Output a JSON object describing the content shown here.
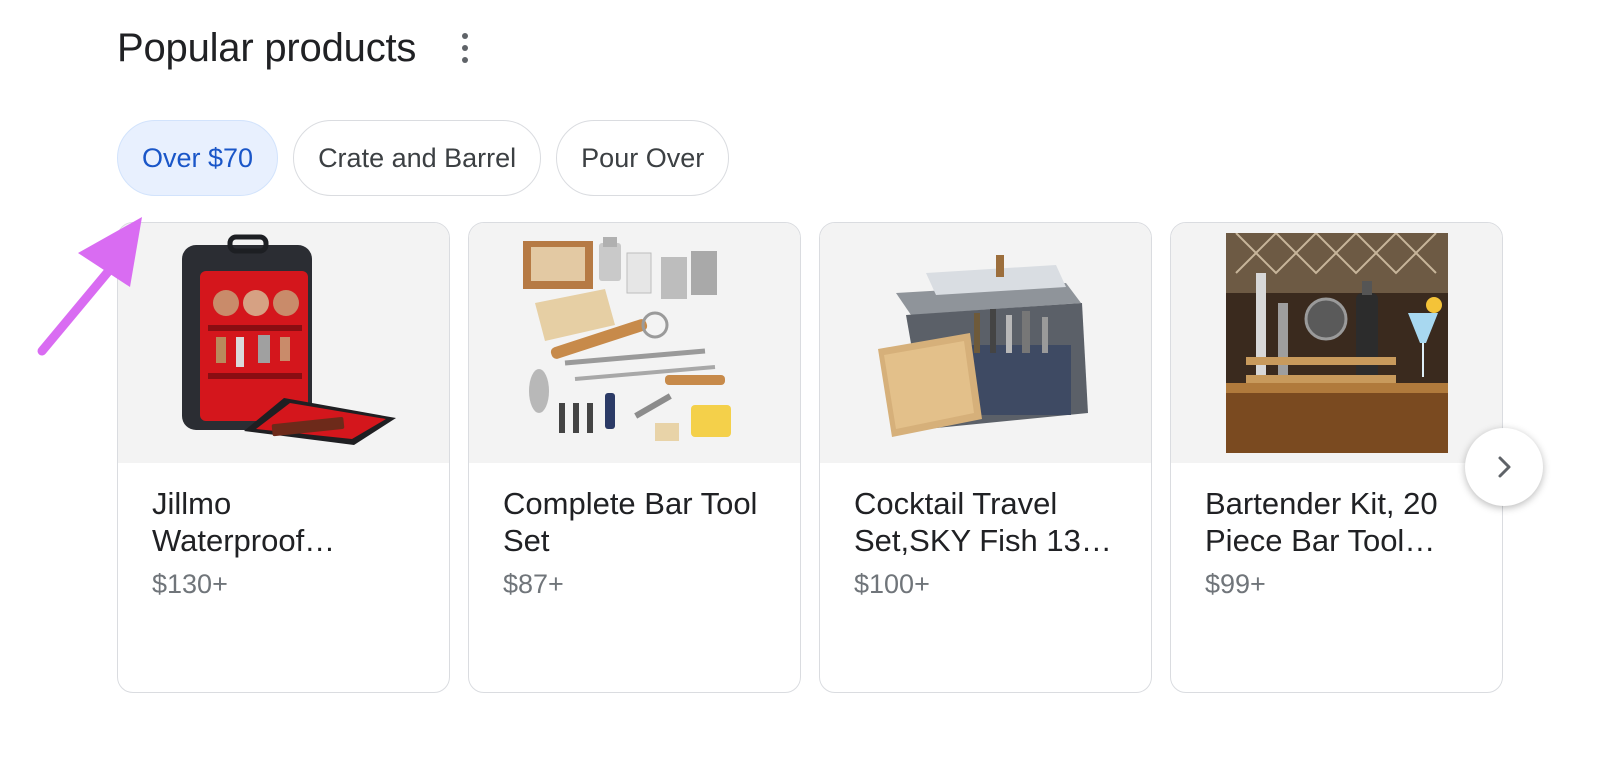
{
  "header": {
    "title": "Popular products",
    "more_icon": "more-vert-icon"
  },
  "chips": [
    {
      "label": "Over $70",
      "selected": true
    },
    {
      "label": "Crate and Barrel",
      "selected": false
    },
    {
      "label": "Pour Over",
      "selected": false
    }
  ],
  "products": [
    {
      "title": "Jillmo Waterproof…",
      "price": "$130+",
      "image": "bartender-backpack-image"
    },
    {
      "title": "Complete Bar Tool Set",
      "price": "$87+",
      "image": "bar-tool-set-image"
    },
    {
      "title": "Cocktail Travel Set,SKY Fish 13…",
      "price": "$100+",
      "image": "cocktail-travel-bag-image"
    },
    {
      "title": "Bartender Kit, 20 Piece Bar Tool…",
      "price": "$99+",
      "image": "bartender-kit-stand-image"
    }
  ],
  "next_icon": "chevron-right-icon",
  "colors": {
    "active_chip_bg": "#e8f0fe",
    "active_chip_text": "#1a56c8",
    "annotation_arrow": "#d96cf2"
  }
}
